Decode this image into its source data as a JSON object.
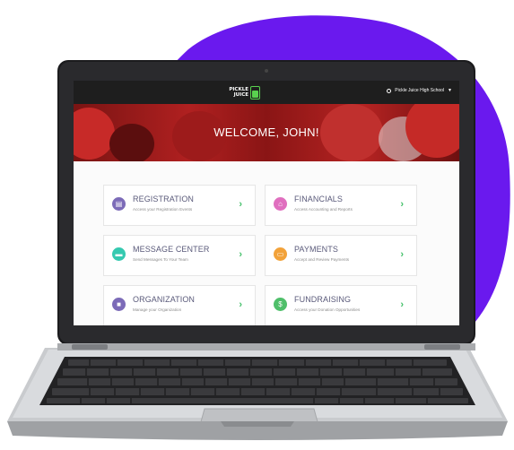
{
  "colors": {
    "blob": "#6a19ee",
    "topbar": "#1e1e1e",
    "logo_green": "#59d14f",
    "arrow_green": "#44c06a"
  },
  "header": {
    "logo_line1": "PICKLE",
    "logo_line2": "JUICE",
    "school_name": "Pickle Juice High School",
    "school_icon": "globe-icon",
    "dropdown_icon": "caret-down-icon"
  },
  "banner": {
    "title": "WELCOME, JOHN!"
  },
  "cards": [
    {
      "title": "REGISTRATION",
      "subtitle": "Access your Registration Events",
      "icon": "clipboard-icon",
      "color": "#7c6bb8"
    },
    {
      "title": "FINANCIALS",
      "subtitle": "Access Accounting and Reports",
      "icon": "bank-icon",
      "color": "#e06fbf"
    },
    {
      "title": "MESSAGE CENTER",
      "subtitle": "Send Messages To Your Team",
      "icon": "chat-icon",
      "color": "#35c9b0"
    },
    {
      "title": "PAYMENTS",
      "subtitle": "Accept and Review Payments",
      "icon": "card-icon",
      "color": "#f2a23a"
    },
    {
      "title": "ORGANIZATION",
      "subtitle": "Manage your Organization",
      "icon": "briefcase-icon",
      "color": "#7c6bb8"
    },
    {
      "title": "FUNDRAISING",
      "subtitle": "Access your Donation Opportunities",
      "icon": "dollar-icon",
      "color": "#4fbf6a"
    }
  ],
  "arrow_glyph": "›"
}
